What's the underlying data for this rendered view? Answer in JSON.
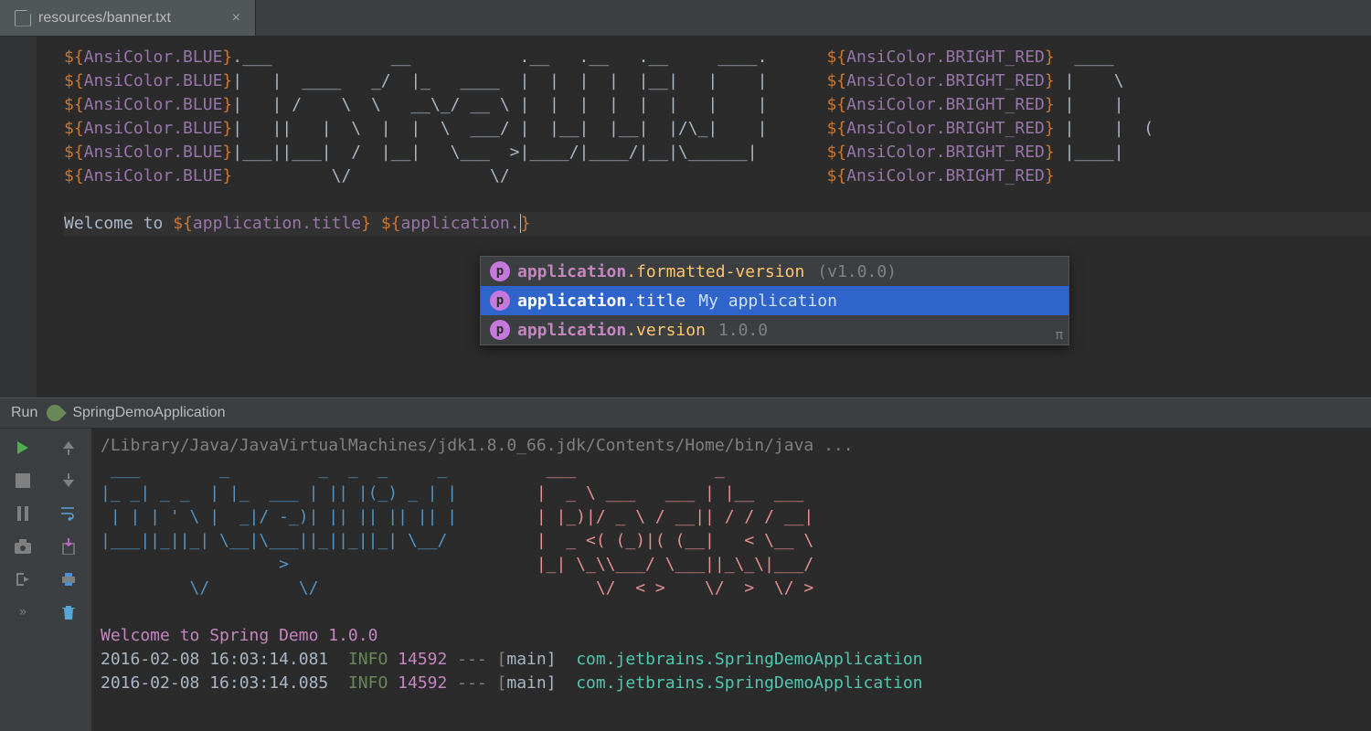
{
  "tab": {
    "label": "resources/banner.txt",
    "close_glyph": "×"
  },
  "editor": {
    "ansi_var_blue": "AnsiColor.BLUE",
    "ansi_var_red": "AnsiColor.BRIGHT_RED",
    "welcome_prefix": "Welcome to ",
    "var_title": "application.title",
    "var_partial": "application.",
    "ascii_rows": [
      ".___            __           .__   .__   .__     ____.",
      "|   |  ____   _/  |_   ____  |  |  |  |  |__|   |    |",
      "|   | /    \\  \\   __\\_/ __ \\ |  |  |  |  |  |   |    |",
      "|   ||   |  \\  |  |  \\  ___/ |  |__|  |__|  |/\\_|    |",
      "|___||___|  /  |__|   \\___  >|____/|____/|__|\\______|",
      "          \\/              \\/"
    ],
    "ascii_red_rows": [
      " ____",
      "|    \\",
      "|    |",
      "|    |  (",
      "|____|",
      ""
    ]
  },
  "popup": {
    "badge": "p",
    "items": [
      {
        "pkg": "application",
        "suffix": ".formatted-version",
        "value": "(v1.0.0)",
        "selected": false
      },
      {
        "pkg": "application",
        "suffix": ".title",
        "value": "My application",
        "selected": true
      },
      {
        "pkg": "application",
        "suffix": ".version",
        "value": "1.0.0",
        "selected": false
      }
    ],
    "pi": "π"
  },
  "runbar": {
    "label": "Run",
    "config_name": "SpringDemoApplication"
  },
  "console": {
    "cmd": "/Library/Java/JavaVirtualMachines/jdk1.8.0_66.jdk/Contents/Home/bin/java ...",
    "ascii_blue": [
      " ___        _         _  _  _     _ ",
      "|_ _| _ _  | |_  ___ | || |(_) _ | |",
      " | | | ' \\ |  _|/ -_)| || || || || |",
      "|___||_||_| \\__|\\___||_||_||_| \\__/ ",
      "                  >                  ",
      "         \\/         \\/               "
    ],
    "ascii_red": [
      " ___              _         ",
      "|  _ \\ ___   ___ | |__  ___ ",
      "| |_)|/ _ \\ / __|| / / / __|",
      "|  _ <( (_)|( (__|   < \\__ \\",
      "|_| \\_\\\\___/ \\___||_\\_\\|___/",
      "      \\/  < >    \\/  >  \\/ >"
    ],
    "welcome": "Welcome to Spring Demo 1.0.0",
    "log_rows": [
      {
        "ts": "2016-02-08 16:03:14.081",
        "level": "INFO",
        "pid": "14592",
        "sep": "--- [",
        "thread": "main]",
        "cls": "com.jetbrains.SpringDemoApplication"
      },
      {
        "ts": "2016-02-08 16:03:14.085",
        "level": "INFO",
        "pid": "14592",
        "sep": "--- [",
        "thread": "main]",
        "cls": "com.jetbrains.SpringDemoApplication"
      }
    ]
  },
  "tool_icons": {
    "more": "»"
  }
}
